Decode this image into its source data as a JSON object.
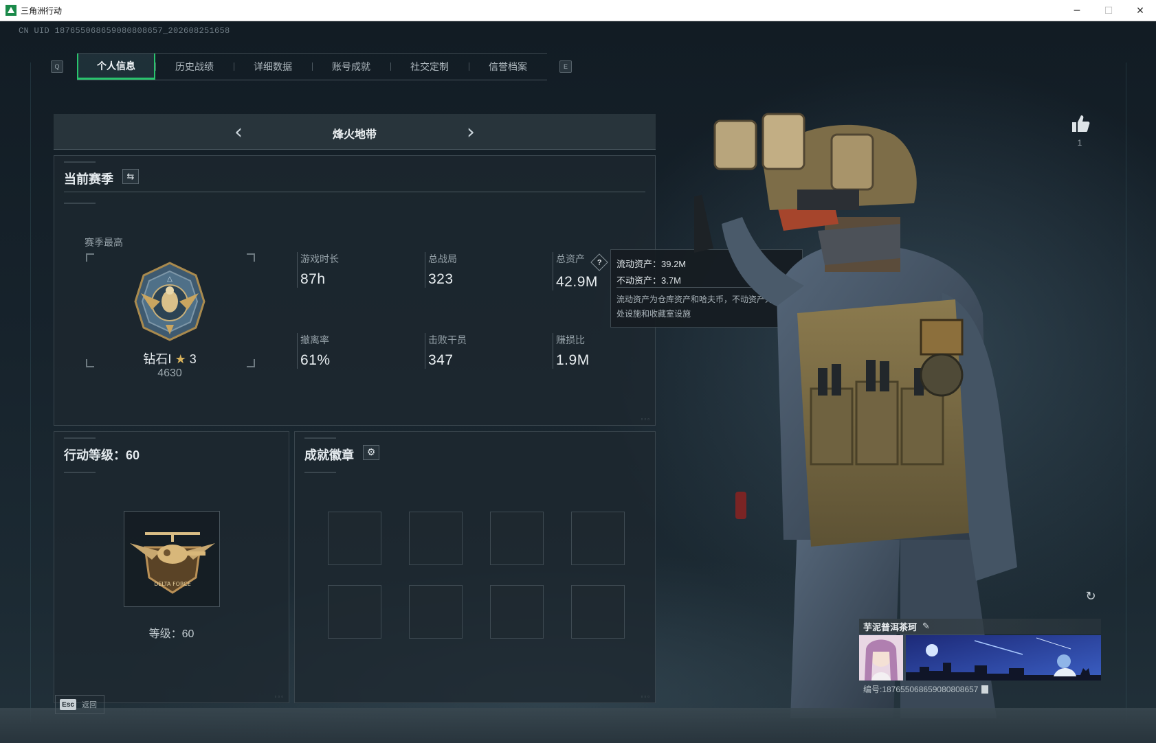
{
  "window": {
    "title": "三角洲行动",
    "minimize": "─",
    "maximize": "☐",
    "close": "✕"
  },
  "uid_line": "CN UID 18765506865908080​8657_202608251658",
  "watermark_title": "",
  "tabs": {
    "prev_key": "Q",
    "next_key": "E",
    "items": [
      {
        "label": "个人信息",
        "active": true
      },
      {
        "label": "历史战绩",
        "active": false
      },
      {
        "label": "详细数据",
        "active": false
      },
      {
        "label": "账号成就",
        "active": false
      },
      {
        "label": "社交定制",
        "active": false
      },
      {
        "label": "信誉档案",
        "active": false
      }
    ]
  },
  "mode_selector": {
    "label": "烽火地带",
    "prev_icon": "chevron-left",
    "next_icon": "chevron-right"
  },
  "season": {
    "title": "当前赛季",
    "season_best_label": "赛季最高",
    "rank_name": "钻石Ⅰ",
    "rank_stars": "3",
    "rank_points": "4630",
    "stats": [
      {
        "label": "游戏时长",
        "value": "87h"
      },
      {
        "label": "总战局",
        "value": "323"
      },
      {
        "label": "总资产",
        "value": "42.9M",
        "has_help": true
      },
      {
        "label": "撤离率",
        "value": "61%"
      },
      {
        "label": "击败干员",
        "value": "347"
      },
      {
        "label": "赚损比",
        "value": "1.9M"
      }
    ]
  },
  "tooltip": {
    "liquid": "流动资产：39.2M",
    "fixed": "不动资产：3.7M",
    "note": "流动资产为仓库资产和哈夫币，不动资产为特勤处设施和收藏室设施"
  },
  "level_panel": {
    "title": "行动等级：60",
    "level_text": "等级：60"
  },
  "badges_panel": {
    "title": "成就徽章",
    "slots": 8
  },
  "profile": {
    "like_count": "1",
    "name": "芋泥普洱茶珂",
    "id_text": "编号:18765506865908080​8657"
  },
  "footer": {
    "esc_key": "Esc",
    "esc_label": "返回"
  },
  "colors": {
    "accent": "#29c46d",
    "background": "#0e161d",
    "panel": "#1e282f"
  }
}
